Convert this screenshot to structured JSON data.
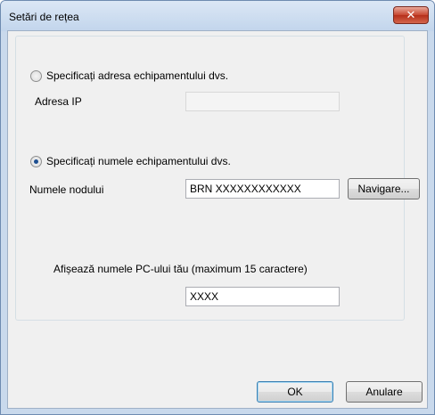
{
  "window": {
    "title": "Setări de rețea",
    "close_glyph": "✕"
  },
  "options": {
    "address": {
      "label": "Specificați adresa echipamentului dvs.",
      "checked": false,
      "ip_label": "Adresa IP",
      "ip_value": ""
    },
    "name": {
      "label": "Specificați numele echipamentului dvs.",
      "checked": true,
      "node_label": "Numele nodului",
      "node_value": "BRN XXXXXXXXXXXX",
      "browse_label": "Navigare..."
    }
  },
  "pc_name": {
    "label": "Afișează numele PC-ului tău (maximum 15 caractere)",
    "value": "XXXX"
  },
  "footer": {
    "ok_label": "OK",
    "cancel_label": "Anulare"
  },
  "icons": {
    "close": "close-icon",
    "radio_unchecked": "radio-unchecked-icon",
    "radio_checked": "radio-checked-icon"
  }
}
